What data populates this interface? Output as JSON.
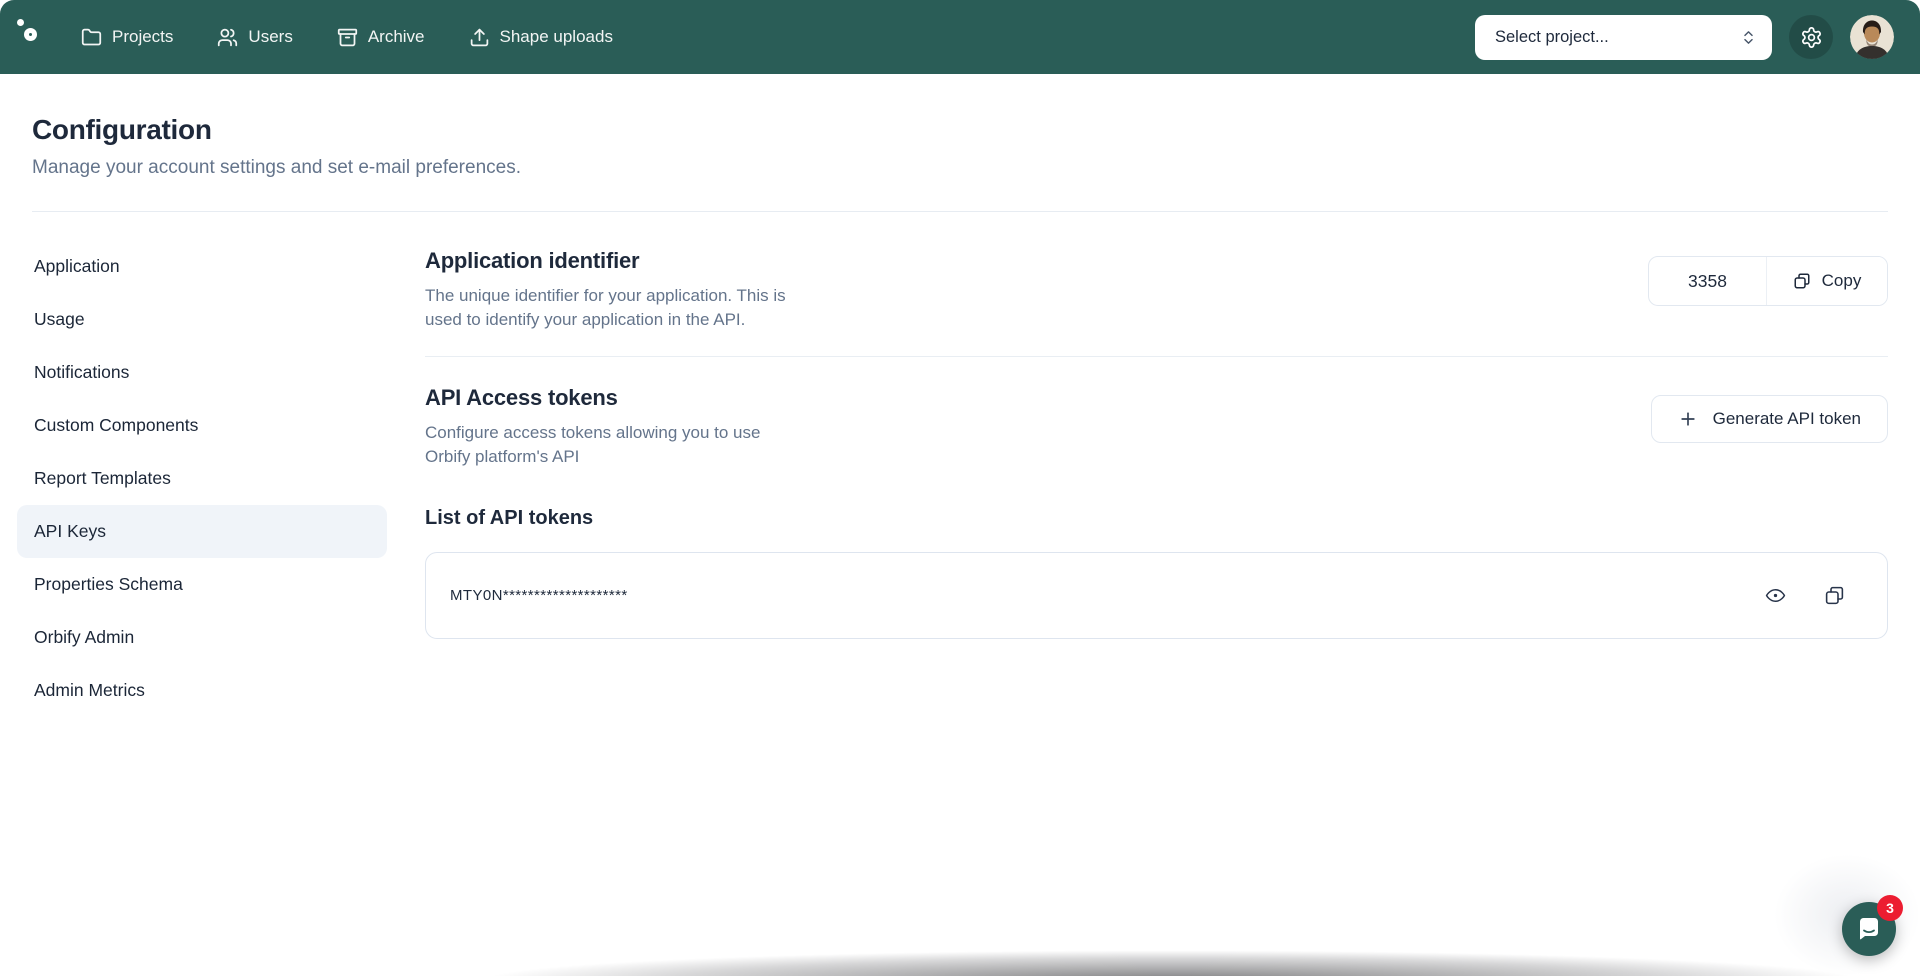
{
  "nav": {
    "items": [
      {
        "label": "Projects",
        "icon": "folder-icon"
      },
      {
        "label": "Users",
        "icon": "users-icon"
      },
      {
        "label": "Archive",
        "icon": "archive-icon"
      },
      {
        "label": "Shape uploads",
        "icon": "upload-icon"
      }
    ],
    "project_select": {
      "placeholder": "Select project...",
      "icon": "chevrons-up-down-icon"
    }
  },
  "header": {
    "title": "Configuration",
    "subtitle": "Manage your account settings and set e-mail preferences."
  },
  "sidebar": {
    "items": [
      {
        "label": "Application",
        "active": false
      },
      {
        "label": "Usage",
        "active": false
      },
      {
        "label": "Notifications",
        "active": false
      },
      {
        "label": "Custom Components",
        "active": false
      },
      {
        "label": "Report Templates",
        "active": false
      },
      {
        "label": "API Keys",
        "active": true
      },
      {
        "label": "Properties Schema",
        "active": false
      },
      {
        "label": "Orbify Admin",
        "active": false
      },
      {
        "label": "Admin Metrics",
        "active": false
      }
    ]
  },
  "sections": {
    "app_identifier": {
      "title": "Application identifier",
      "description": "The unique identifier for your application. This is used to identify your application in the API.",
      "value": "3358",
      "copy_label": "Copy"
    },
    "api_tokens": {
      "title": "API Access tokens",
      "description": "Configure access tokens allowing you to use Orbify platform's API",
      "generate_label": "Generate API token",
      "list_title": "List of API tokens",
      "tokens": [
        {
          "masked": "MTY0N********************"
        }
      ]
    }
  },
  "chat": {
    "unread_badge": "3"
  },
  "colors": {
    "nav_teal": "#2A5D57",
    "badge_red": "#EC1D31",
    "active_item_bg": "#F0F4F9",
    "border": "#E2E8F0",
    "title_text": "#1E293B",
    "muted_text": "#64748B"
  }
}
